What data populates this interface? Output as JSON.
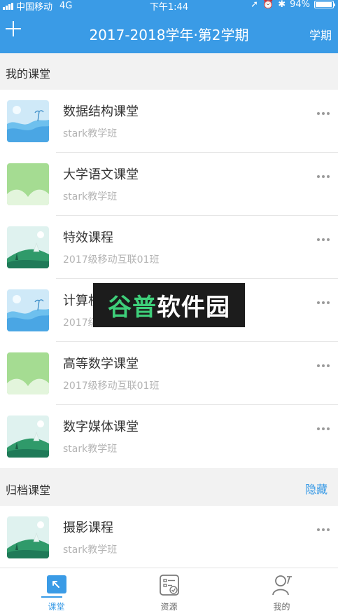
{
  "status_bar": {
    "carrier": "中国移动",
    "network": "4G",
    "time": "下午1:44",
    "battery": "94%",
    "battery_level": 0.94
  },
  "nav": {
    "title": "2017-2018学年·第2学期",
    "right_label": "学期"
  },
  "my_section": {
    "title": "我的课堂"
  },
  "courses": [
    {
      "name": "数据结构课堂",
      "class": "stark教学班",
      "thumb": "beach"
    },
    {
      "name": "大学语文课堂",
      "class": "stark教学班",
      "thumb": "green"
    },
    {
      "name": "特效课程",
      "class": "2017级移动互联01班",
      "thumb": "hill"
    },
    {
      "name": "计算机...",
      "class": "2017级移动互联01班",
      "thumb": "beach"
    },
    {
      "name": "高等数学课堂",
      "class": "2017级移动互联01班",
      "thumb": "green"
    },
    {
      "name": "数字媒体课堂",
      "class": "stark教学班",
      "thumb": "hill"
    }
  ],
  "archive_section": {
    "title": "归档课堂",
    "action": "隐藏"
  },
  "archived_courses": [
    {
      "name": "摄影课程",
      "class": "stark教学班",
      "thumb": "hill"
    }
  ],
  "watermark": {
    "text_a": "谷普",
    "text_b": "软件园"
  },
  "tabs": [
    {
      "label": "课堂",
      "icon": "classroom-icon",
      "active": true
    },
    {
      "label": "资源",
      "icon": "resources-icon",
      "active": false
    },
    {
      "label": "我的",
      "icon": "profile-icon",
      "active": false
    }
  ],
  "colors": {
    "primary": "#3a9be6",
    "thumb_sky": "#bfe3f7",
    "thumb_green": "#cdeec0",
    "thumb_hill": "#2f9a6a"
  }
}
